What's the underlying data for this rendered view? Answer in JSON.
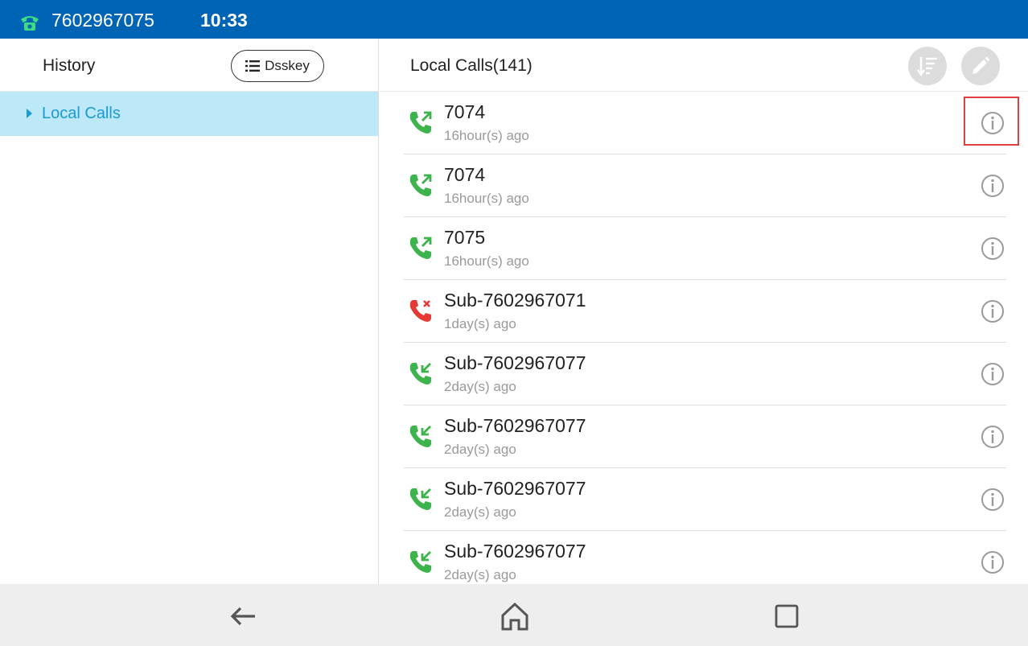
{
  "status_bar": {
    "extension": "7602967075",
    "time": "10:33"
  },
  "left_panel": {
    "title": "History",
    "dsskey_label": "Dsskey",
    "nav_items": [
      {
        "label": "Local Calls",
        "selected": true
      }
    ]
  },
  "right_panel": {
    "title": "Local Calls(141)",
    "calls": [
      {
        "name": "7074",
        "time": "16hour(s) ago",
        "type": "outgoing",
        "highlighted": true
      },
      {
        "name": "7074",
        "time": "16hour(s) ago",
        "type": "outgoing"
      },
      {
        "name": "7075",
        "time": "16hour(s) ago",
        "type": "outgoing"
      },
      {
        "name": "Sub-7602967071",
        "time": "1day(s) ago",
        "type": "missed"
      },
      {
        "name": "Sub-7602967077",
        "time": "2day(s) ago",
        "type": "incoming"
      },
      {
        "name": "Sub-7602967077",
        "time": "2day(s) ago",
        "type": "incoming"
      },
      {
        "name": "Sub-7602967077",
        "time": "2day(s) ago",
        "type": "incoming"
      },
      {
        "name": "Sub-7602967077",
        "time": "2day(s) ago",
        "type": "incoming"
      }
    ]
  },
  "colors": {
    "status_bar": "#0064b4",
    "accent": "#1a9ad6",
    "selected_bg": "#bde8f8",
    "call_green": "#3cb44b",
    "call_red": "#e53935",
    "highlight": "#e0403f"
  },
  "icons": {
    "status_phone": "phone-icon",
    "dsskey": "list-icon",
    "sort": "sort-icon",
    "edit": "pencil-icon",
    "outgoing": "outgoing-call-icon",
    "incoming": "incoming-call-icon",
    "missed": "missed-call-icon",
    "info": "info-icon",
    "back": "back-arrow-icon",
    "home": "home-icon",
    "recent": "recent-apps-icon"
  }
}
